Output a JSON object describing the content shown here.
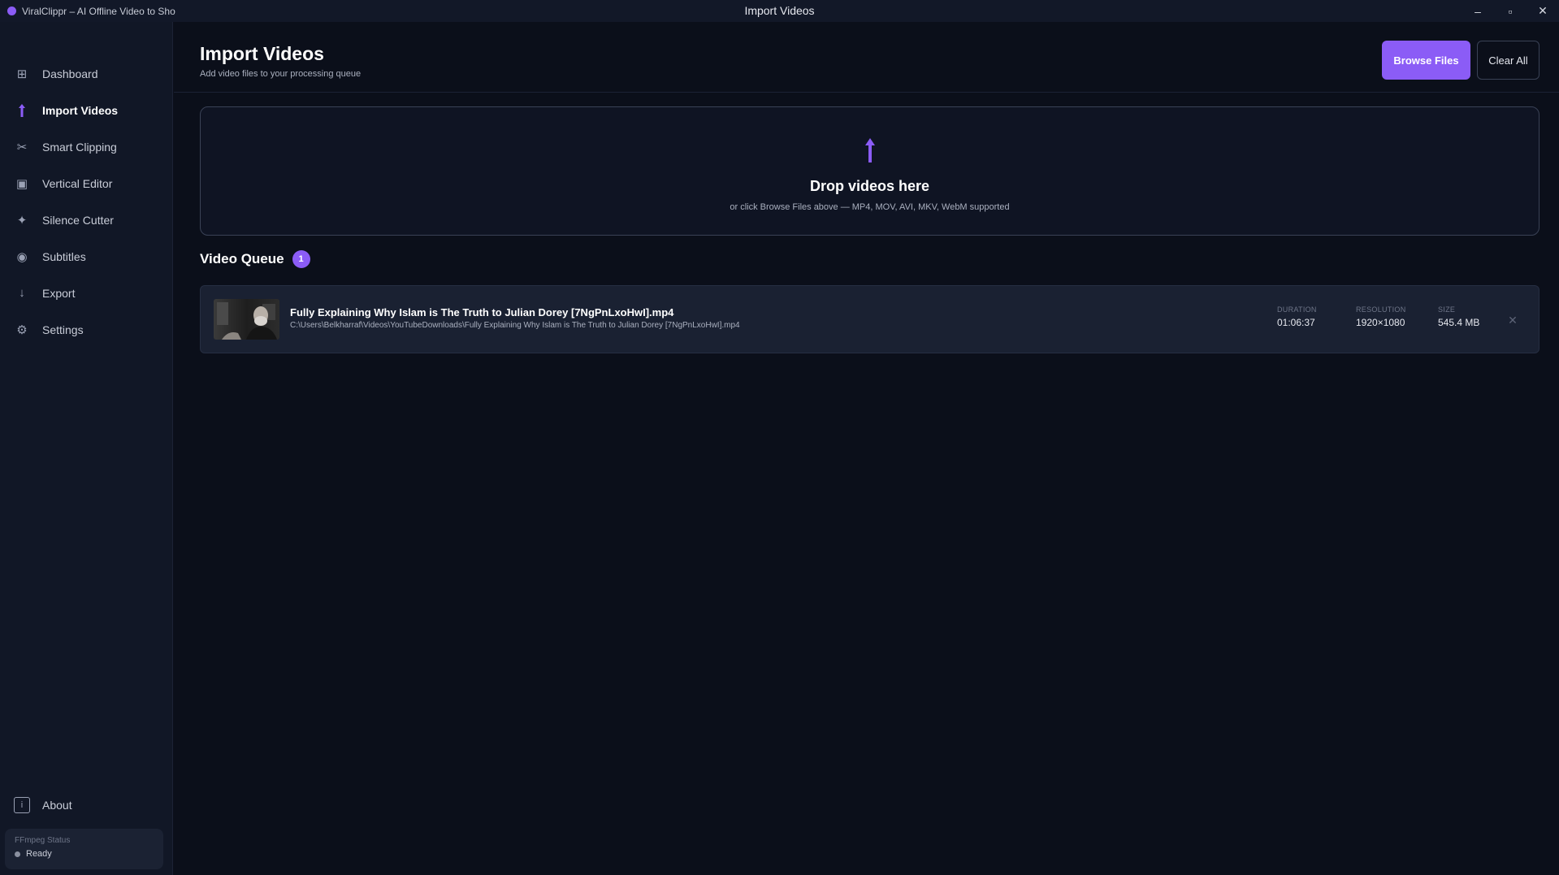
{
  "titlebar": {
    "app_name": "ViralClippr – AI Offline Video to Sho",
    "window_title": "Import Videos",
    "minimize": "–",
    "maximize": "▫",
    "close": "✕"
  },
  "sidebar": {
    "items": [
      {
        "label": "Dashboard",
        "icon": "grid-icon",
        "glyph": "⊞"
      },
      {
        "label": "Import Videos",
        "icon": "upload-icon",
        "glyph": "⬆",
        "active": true
      },
      {
        "label": "Smart Clipping",
        "icon": "scissors-icon",
        "glyph": "✂"
      },
      {
        "label": "Vertical Editor",
        "icon": "frame-icon",
        "glyph": "▣"
      },
      {
        "label": "Silence Cutter",
        "icon": "sparkle-icon",
        "glyph": "✦"
      },
      {
        "label": "Subtitles",
        "icon": "record-icon",
        "glyph": "◉"
      },
      {
        "label": "Export",
        "icon": "download-icon",
        "glyph": "↓"
      },
      {
        "label": "Settings",
        "icon": "gear-icon",
        "glyph": "⚙"
      }
    ],
    "about": {
      "label": "About",
      "icon": "info-icon",
      "glyph": "i"
    },
    "ffmpeg": {
      "title": "FFmpeg Status",
      "status": "Ready"
    }
  },
  "header": {
    "title": "Import Videos",
    "subtitle": "Add video files to your processing queue",
    "browse_label": "Browse Files",
    "clear_label": "Clear All"
  },
  "dropzone": {
    "title": "Drop videos here",
    "subtitle": "or click Browse Files above — MP4, MOV, AVI, MKV, WebM supported"
  },
  "queue": {
    "title": "Video Queue",
    "count": "1",
    "items": [
      {
        "name": "Fully Explaining Why Islam is The Truth to Julian Dorey [7NgPnLxoHwI].mp4",
        "path": "C:\\Users\\Belkharraf\\Videos\\YouTubeDownloads\\Fully Explaining Why Islam is The Truth to Julian Dorey [7NgPnLxoHwI].mp4",
        "duration_label": "DURATION",
        "duration": "01:06:37",
        "resolution_label": "RESOLUTION",
        "resolution": "1920×1080",
        "size_label": "SIZE",
        "size": "545.4 MB"
      }
    ]
  },
  "colors": {
    "accent": "#8b5cf6",
    "background": "#0b0f1a",
    "sidebar": "#111726",
    "card": "#1a2132"
  }
}
